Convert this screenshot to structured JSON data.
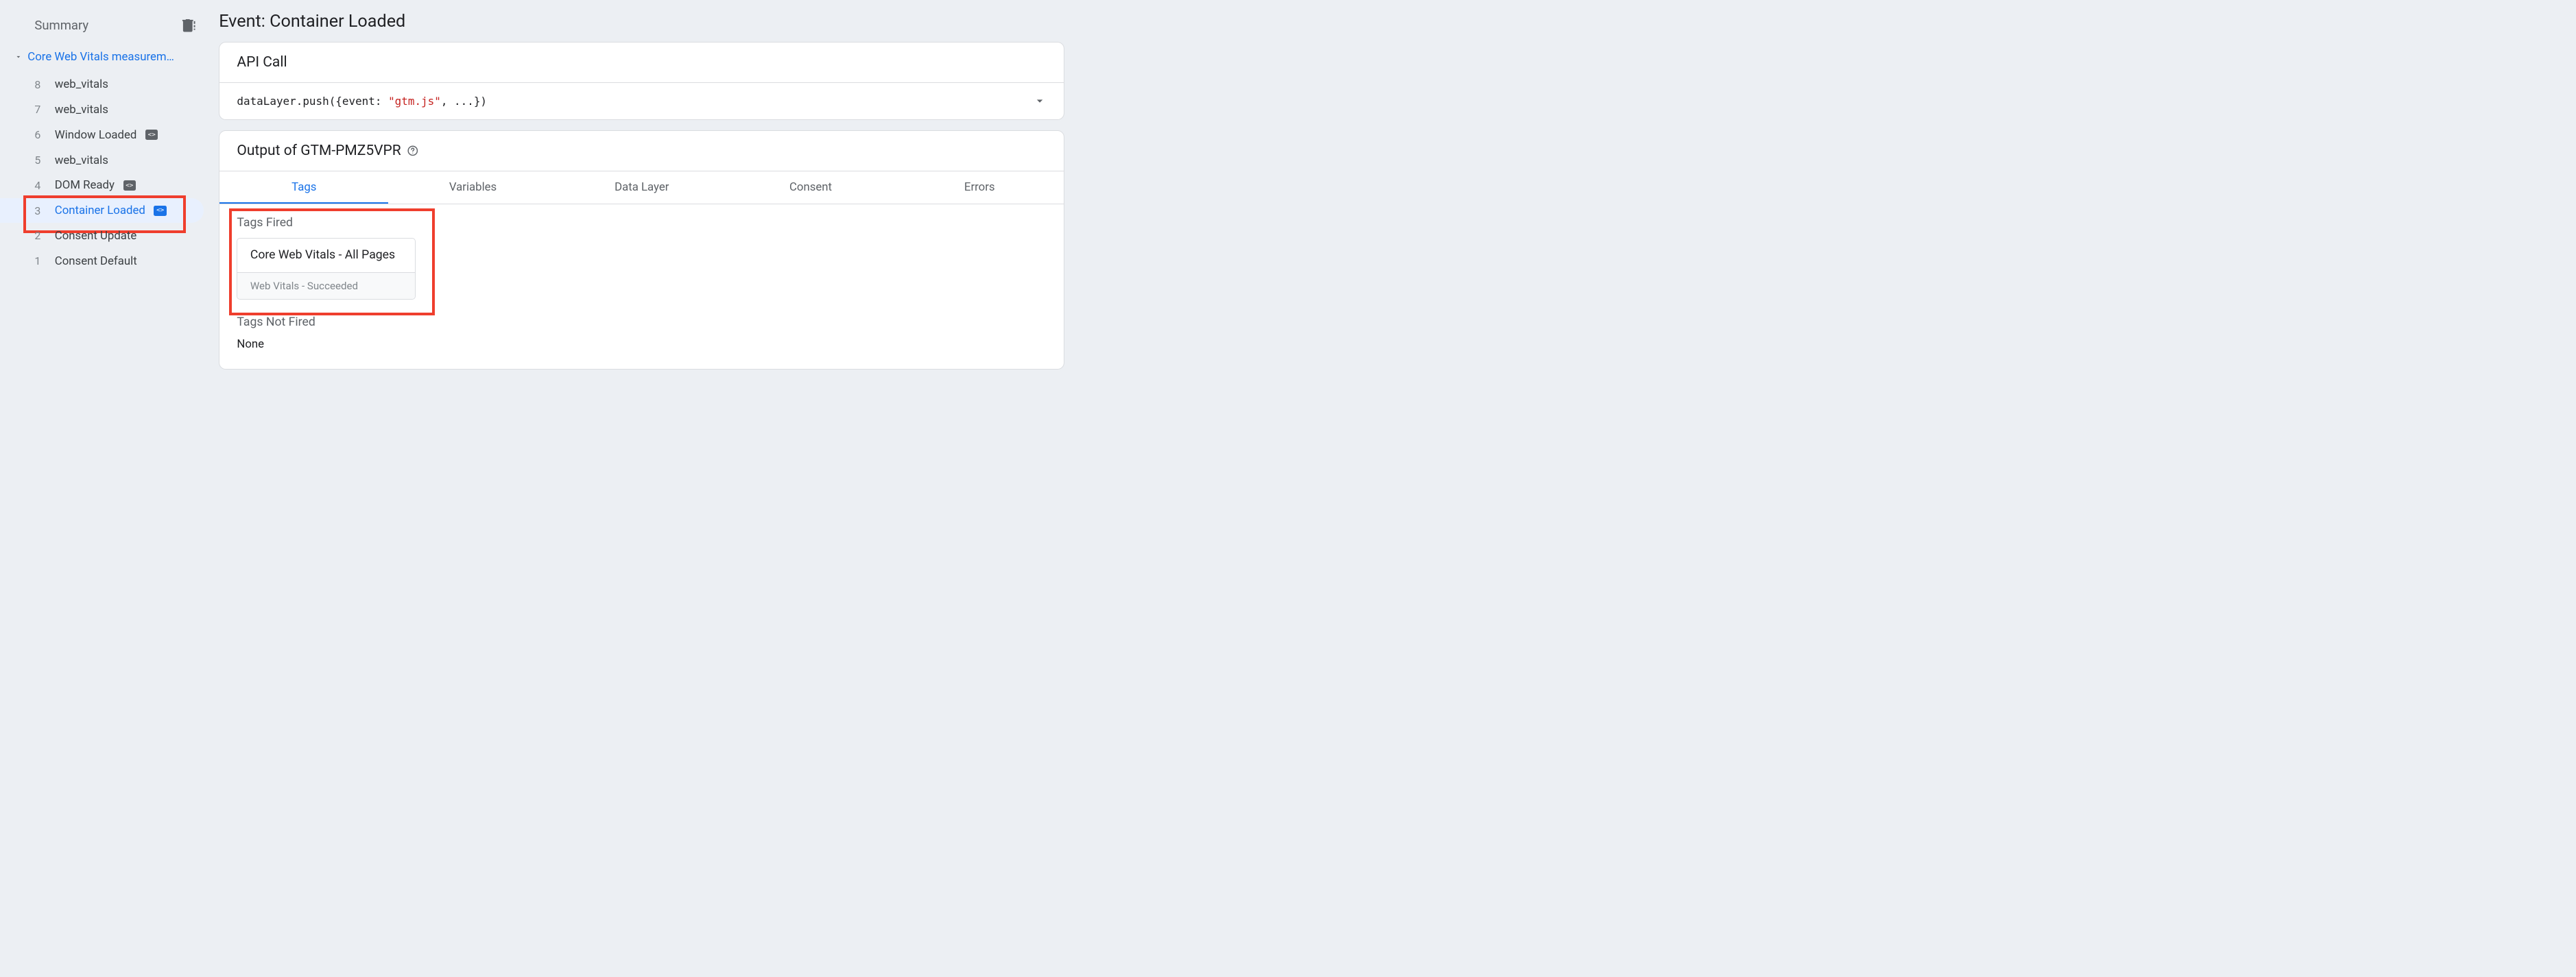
{
  "sidebar": {
    "title": "Summary",
    "group_label": "Core Web Vitals measurem…",
    "events": [
      {
        "num": "8",
        "name": "web_vitals",
        "badge": false,
        "selected": false
      },
      {
        "num": "7",
        "name": "web_vitals",
        "badge": false,
        "selected": false
      },
      {
        "num": "6",
        "name": "Window Loaded",
        "badge": true,
        "selected": false
      },
      {
        "num": "5",
        "name": "web_vitals",
        "badge": false,
        "selected": false
      },
      {
        "num": "4",
        "name": "DOM Ready",
        "badge": true,
        "selected": false
      },
      {
        "num": "3",
        "name": "Container Loaded",
        "badge": true,
        "selected": true
      },
      {
        "num": "2",
        "name": "Consent Update",
        "badge": false,
        "selected": false
      },
      {
        "num": "1",
        "name": "Consent Default",
        "badge": false,
        "selected": false
      }
    ]
  },
  "main": {
    "title": "Event: Container Loaded",
    "api_call": {
      "heading": "API Call",
      "code_prefix": "dataLayer.push({event: ",
      "code_string": "\"gtm.js\"",
      "code_suffix": ", ...})"
    },
    "output": {
      "heading": "Output of GTM-PMZ5VPR",
      "tabs": [
        "Tags",
        "Variables",
        "Data Layer",
        "Consent",
        "Errors"
      ],
      "active_tab": 0,
      "fired_label": "Tags Fired",
      "fired_tags": [
        {
          "title": "Core Web Vitals - All Pages",
          "status": "Web Vitals - Succeeded"
        }
      ],
      "not_fired_label": "Tags Not Fired",
      "not_fired_text": "None"
    }
  }
}
